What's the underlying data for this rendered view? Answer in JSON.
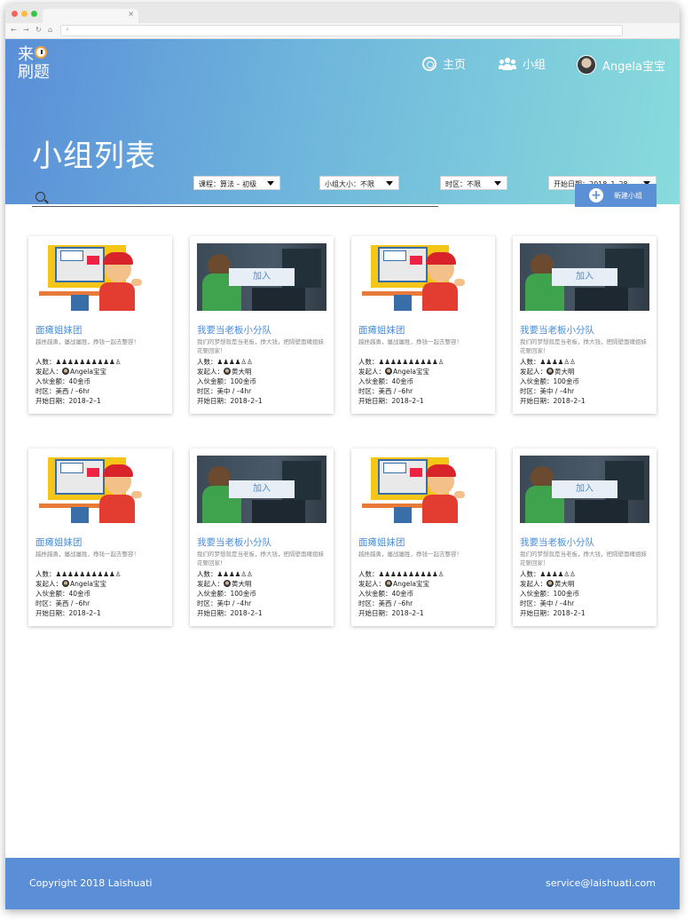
{
  "browser": {
    "tab_close": "×",
    "search_glyph": "⌕"
  },
  "logo": {
    "line1": "来",
    "line2": "刷题"
  },
  "nav": {
    "home": "主页",
    "groups": "小组",
    "user": "Angela宝宝"
  },
  "page_title": "小组列表",
  "filters": [
    {
      "label": "课程：算法 – 初级"
    },
    {
      "label": "小组大小：不限"
    },
    {
      "label": "时区：不限"
    },
    {
      "label": "开始日期：2018–1–28"
    }
  ],
  "search": {
    "placeholder": ""
  },
  "new_group_button": "新建小组",
  "labels": {
    "members": "人数：",
    "initiator": "发起人：",
    "fee": "入伙金额：",
    "timezone": "时区：",
    "start": "开始日期：",
    "join": "加入"
  },
  "cards": [
    {
      "title": "面瘫姐妹团",
      "desc": "越挫越勇，屡战屡胜，挣钱一起去整容！",
      "members_icons": "♟♟♟♟♟♟♟♟♟♟♙",
      "initiator": "Angela宝宝",
      "fee": "40金币",
      "timezone": "美西 / –6hr",
      "start": "2018–2–1",
      "image": "cartoon"
    },
    {
      "title": "我要当老板小分队",
      "desc": "我们的梦想就是当老板，挣大钱，把隔壁面瘫姐妹花娶回家！",
      "members_icons": "♟♟♟♟♙♙",
      "initiator": "黄大明",
      "fee": "100金币",
      "timezone": "美中 / –4hr",
      "start": "2018–2–1",
      "image": "dark"
    },
    {
      "title": "面瘫姐妹团",
      "desc": "越挫越勇，屡战屡胜，挣钱一起去整容！",
      "members_icons": "♟♟♟♟♟♟♟♟♟♟♙",
      "initiator": "Angela宝宝",
      "fee": "40金币",
      "timezone": "美西 / –6hr",
      "start": "2018–2–1",
      "image": "cartoon"
    },
    {
      "title": "我要当老板小分队",
      "desc": "我们的梦想就是当老板，挣大钱，把隔壁面瘫姐妹花娶回家！",
      "members_icons": "♟♟♟♟♙♙",
      "initiator": "黄大明",
      "fee": "100金币",
      "timezone": "美中 / –4hr",
      "start": "2018–2–1",
      "image": "dark"
    },
    {
      "title": "面瘫姐妹团",
      "desc": "越挫越勇，屡战屡胜，挣钱一起去整容！",
      "members_icons": "♟♟♟♟♟♟♟♟♟♟♙",
      "initiator": "Angela宝宝",
      "fee": "40金币",
      "timezone": "美西 / –6hr",
      "start": "2018–2–1",
      "image": "cartoon"
    },
    {
      "title": "我要当老板小分队",
      "desc": "我们的梦想就是当老板，挣大钱，把隔壁面瘫姐妹花娶回家！",
      "members_icons": "♟♟♟♟♙♙",
      "initiator": "黄大明",
      "fee": "100金币",
      "timezone": "美中 / –4hr",
      "start": "2018–2–1",
      "image": "dark"
    },
    {
      "title": "面瘫姐妹团",
      "desc": "越挫越勇，屡战屡胜，挣钱一起去整容！",
      "members_icons": "♟♟♟♟♟♟♟♟♟♟♙",
      "initiator": "Angela宝宝",
      "fee": "40金币",
      "timezone": "美西 / –6hr",
      "start": "2018–2–1",
      "image": "cartoon"
    },
    {
      "title": "我要当老板小分队",
      "desc": "我们的梦想就是当老板，挣大钱，把隔壁面瘫姐妹花娶回家！",
      "members_icons": "♟♟♟♟♙♙",
      "initiator": "黄大明",
      "fee": "100金币",
      "timezone": "美中 / –4hr",
      "start": "2018–2–1",
      "image": "dark"
    }
  ],
  "footer": {
    "copyright": "Copyright 2018 Laishuati",
    "email": "service@laishuati.com"
  },
  "colors": {
    "brand": "#5a8ed6",
    "link": "#4a8ed8",
    "hero_end": "#88dcdc"
  }
}
